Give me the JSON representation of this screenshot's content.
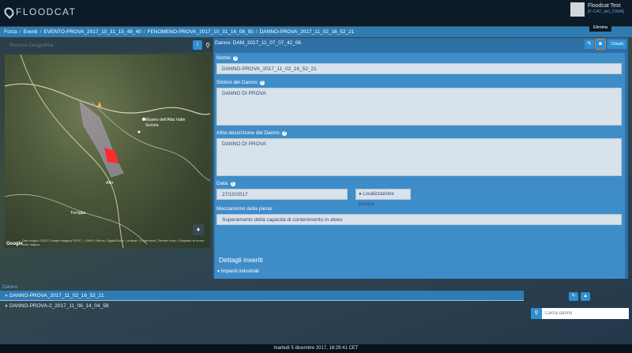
{
  "app": {
    "logo_text": "FLOODCAT"
  },
  "user": {
    "name": "Floodcat Test",
    "role": "[F-CAT_del_CIMA]"
  },
  "breadcrumb": [
    "Forza",
    "Eventi",
    "EVENTO-PROVA_2017_10_31_15_48_40",
    "FENOMENO-PROVA_2017_10_31_16_08_50",
    "DANNO-PROVA_2017_11_02_16_52_21"
  ],
  "search": {
    "placeholder": "Ricerca Geografica"
  },
  "map": {
    "place_labels": [
      "Museo dell'Alta Valle Scrivia",
      "Altri",
      "Torriglia"
    ],
    "attribution": "Dati mappa ©2017 Google Imagery ©2017 , CNES / Airbus, DigitalGlobe, Landsat / Copernicus | Termini d'uso | Segnala un errore nella mappa",
    "google_label": "Google",
    "danger_color": "#ff2a2a"
  },
  "panel": {
    "title": "Danno: DAM_2017_11_07_07_42_06",
    "tooltip": "Elimina",
    "close_label": "Chiudi"
  },
  "form": {
    "nome_label": "Nome:",
    "nome_value": "DANNO-PROVA_2017_11_02_16_52_21",
    "sintesi_label": "Sintesi del Danno:",
    "sintesi_value": "DANNO DI PROVA",
    "altra_label": "Altra descrizione del Danno:",
    "altra_value": "DANNO DI PROVA",
    "data_label": "Data:",
    "data_value": "27/10/2017",
    "loc_label": "Localizzazione precisa",
    "mecc_label": "Meccanismo della piena:",
    "mecc_value": "Superamento della capacità di contenimento in alveo",
    "dettagli": "Dettagli inseriti",
    "impianti": "Impianti industriali"
  },
  "list": {
    "header": "Danno",
    "items": [
      "DANNO-PROVA_2017_11_02_16_52_21",
      "DANNO-PROVA-2_2017_11_06_14_04_58"
    ]
  },
  "cerca": {
    "placeholder": "Cerca danno"
  },
  "footer": {
    "datetime": "martedì 5 dicembre 2017, 16:29:41 CET"
  }
}
